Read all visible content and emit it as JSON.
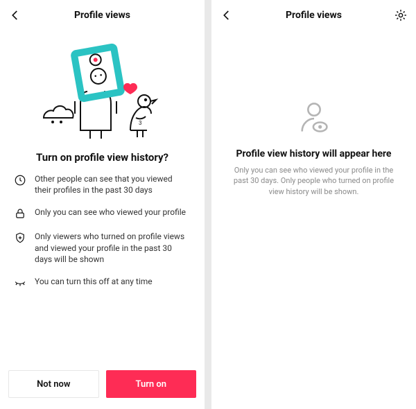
{
  "left": {
    "title": "Profile views",
    "heading": "Turn on profile view history?",
    "items": [
      {
        "icon": "clock-icon",
        "text": "Other people can see that you viewed their profiles in the past 30 days"
      },
      {
        "icon": "lock-icon",
        "text": "Only you can see who viewed your profile"
      },
      {
        "icon": "shield-icon",
        "text": "Only viewers who turned on profile views and viewed your profile in the past 30 days will be shown"
      },
      {
        "icon": "eyelash-icon",
        "text": "You can turn this off at any time"
      }
    ],
    "buttons": {
      "secondary": "Not now",
      "primary": "Turn on"
    },
    "colors": {
      "accent": "#fe2c55"
    }
  },
  "right": {
    "title": "Profile views",
    "empty_title": "Profile view history will appear here",
    "empty_body": "Only you can see who viewed your profile in the past 30 days. Only people who turned on profile view history will be shown."
  }
}
